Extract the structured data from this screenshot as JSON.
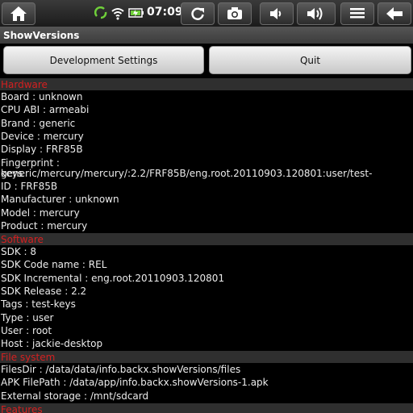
{
  "status_bar": {
    "time": "07:09",
    "icons": [
      "home-icon",
      "sync-icon",
      "wifi-icon",
      "battery-icon",
      "refresh-icon",
      "camera-icon",
      "volume-down-icon",
      "volume-up-icon",
      "menu-icon",
      "back-icon"
    ]
  },
  "app": {
    "title": "ShowVersions"
  },
  "buttons": {
    "dev_settings": "Development Settings",
    "quit": "Quit"
  },
  "sections": {
    "hardware": "Hardware",
    "software": "Software",
    "filesystem": "File system",
    "features": "Features"
  },
  "hardware": {
    "board": "Board : unknown",
    "cpu": "CPU ABI : armeabi",
    "brand": "Brand : generic",
    "device": "Device : mercury",
    "display": "Display : FRF85B",
    "fingerprint1": "Fingerprint : generic/mercury/mercury/:2.2/FRF85B/eng.root.20110903.120801:user/test-",
    "fingerprint2": "keys",
    "id": "ID : FRF85B",
    "manufacturer": "Manufacturer : unknown",
    "model": "Model : mercury",
    "product": "Product : mercury"
  },
  "software": {
    "sdk": "SDK : 8",
    "codename": "SDK Code name : REL",
    "incremental": "SDK Incremental : eng.root.20110903.120801",
    "release": "SDK Release : 2.2",
    "tags": "Tags : test-keys",
    "type": "Type : user",
    "user": "User : root",
    "host": "Host : jackie-desktop"
  },
  "filesystem": {
    "filesdir": "FilesDir : /data/data/info.backx.showVersions/files",
    "apk": "APK FilePath : /data/app/info.backx.showVersions-1.apk",
    "external": "External storage : /mnt/sdcard"
  }
}
